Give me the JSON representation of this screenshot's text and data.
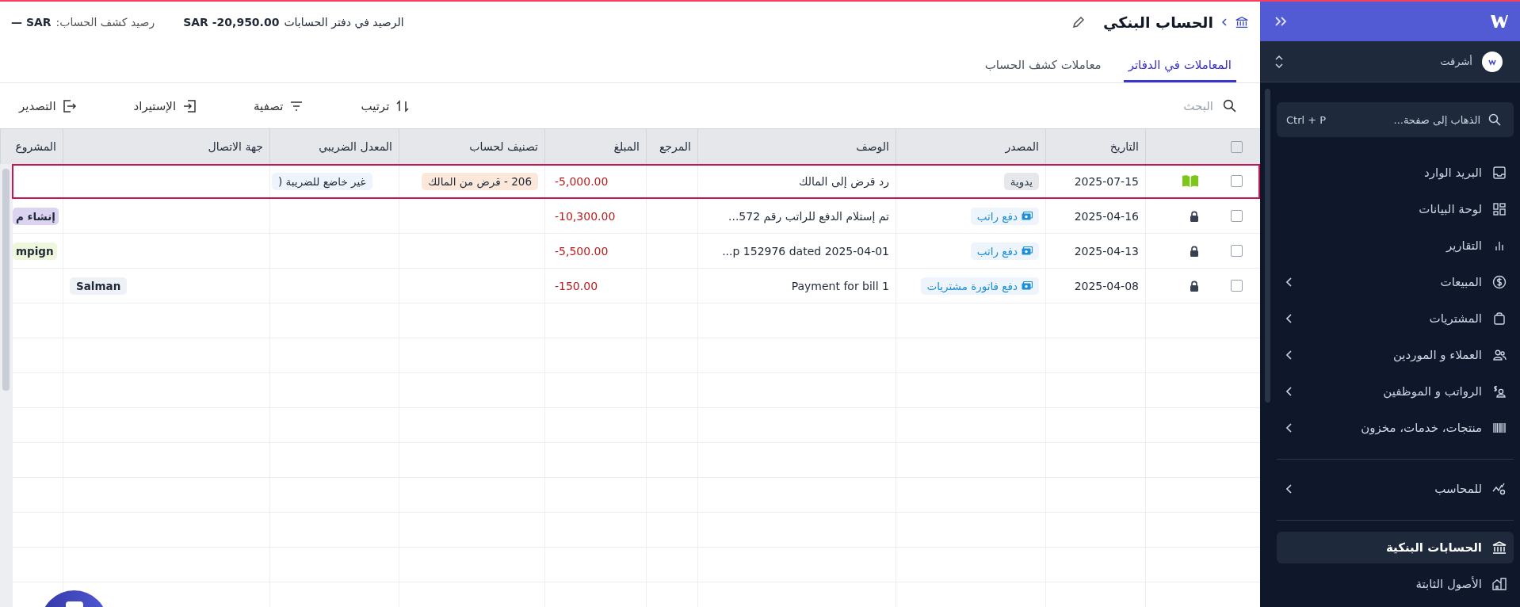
{
  "sidebar": {
    "org": {
      "name": "أشرقت"
    },
    "search": {
      "placeholder": "الذهاب إلى صفحة...",
      "shortcut": "Ctrl + P"
    },
    "sections": [
      {
        "items": [
          {
            "label": "البريد الوارد",
            "kind": "inbox",
            "has_submenu": false,
            "selected": false
          },
          {
            "label": "لوحة البيانات",
            "kind": "dashboard",
            "has_submenu": false,
            "selected": false
          },
          {
            "label": "التقارير",
            "kind": "chart",
            "has_submenu": false,
            "selected": false
          },
          {
            "label": "المبيعات",
            "kind": "dollar",
            "has_submenu": true,
            "selected": false
          },
          {
            "label": "المشتريات",
            "kind": "bag",
            "has_submenu": true,
            "selected": false
          },
          {
            "label": "العملاء و الموردين",
            "kind": "people",
            "has_submenu": true,
            "selected": false
          },
          {
            "label": "الرواتب و الموظفين",
            "kind": "payroll",
            "has_submenu": true,
            "selected": false
          },
          {
            "label": "منتجات، خدمات، مخزون",
            "kind": "barcode",
            "has_submenu": true,
            "selected": false
          }
        ]
      },
      {
        "items": [
          {
            "label": "للمحاسب",
            "kind": "accountant",
            "has_submenu": true,
            "selected": false
          }
        ]
      },
      {
        "items": [
          {
            "label": "الحسابات البنكية",
            "kind": "bank",
            "has_submenu": false,
            "selected": true
          },
          {
            "label": "الأصول الثابتة",
            "kind": "building",
            "has_submenu": false,
            "selected": false
          }
        ]
      }
    ]
  },
  "page": {
    "title": "الحساب البنكي",
    "balances": [
      {
        "label": "الرصيد في دفتر الحسابات",
        "value": "SAR -20,950.00"
      },
      {
        "label": "رصيد كشف الحساب:",
        "value": "SAR —"
      }
    ]
  },
  "tabs": [
    {
      "label": "المعاملات في الدفاتر",
      "selected": true
    },
    {
      "label": "معاملات كشف الحساب",
      "selected": false
    }
  ],
  "toolbar": {
    "search": {
      "placeholder": "البحث"
    },
    "actions": [
      {
        "label": "ترتيب",
        "kind": "sort"
      },
      {
        "label": "تصفية",
        "kind": "filter"
      },
      {
        "label": "الإستيراد",
        "kind": "import"
      },
      {
        "label": "التصدير",
        "kind": "export"
      }
    ]
  },
  "table": {
    "header_checked": false,
    "columns": [
      "التاريخ",
      "المصدر",
      "الوصف",
      "المرجع",
      "المبلغ",
      "تصنيف لحساب",
      "المعدل الضريبي",
      "جهة الاتصال",
      "المشروع"
    ],
    "rows": [
      {
        "selected": true,
        "checked": false,
        "kind": "book",
        "date": "2025-07-15",
        "source": {
          "label": "يدوية",
          "kind": "manual"
        },
        "description": "رد قرض إلى المالك",
        "amount": "-5,000.00",
        "category": "206 - قرض من المالك",
        "tax": "غير خاضع للضريبة ("
      },
      {
        "selected": false,
        "checked": false,
        "kind": "lock",
        "date": "2025-04-16",
        "source": {
          "label": "دفع راتب",
          "kind": "payment"
        },
        "description": "تم إستلام الدفع للراتب رقم 572...",
        "amount": "-10,300.00",
        "project": {
          "label": "إنشاء م",
          "color": "#dcd3f1"
        }
      },
      {
        "selected": false,
        "checked": false,
        "kind": "lock",
        "date": "2025-04-13",
        "source": {
          "label": "دفع راتب",
          "kind": "payment"
        },
        "description": "p 152976 dated 2025-04-01...",
        "amount": "-5,500.00",
        "project": {
          "label": "mpign",
          "color": "#eef7dc"
        }
      },
      {
        "selected": false,
        "checked": false,
        "kind": "lock",
        "date": "2025-04-08",
        "source": {
          "label": "دفع فاتورة مشتريات",
          "kind": "payment"
        },
        "description": "Payment for bill 1",
        "amount": "-150.00",
        "contact": "Salman"
      }
    ]
  }
}
